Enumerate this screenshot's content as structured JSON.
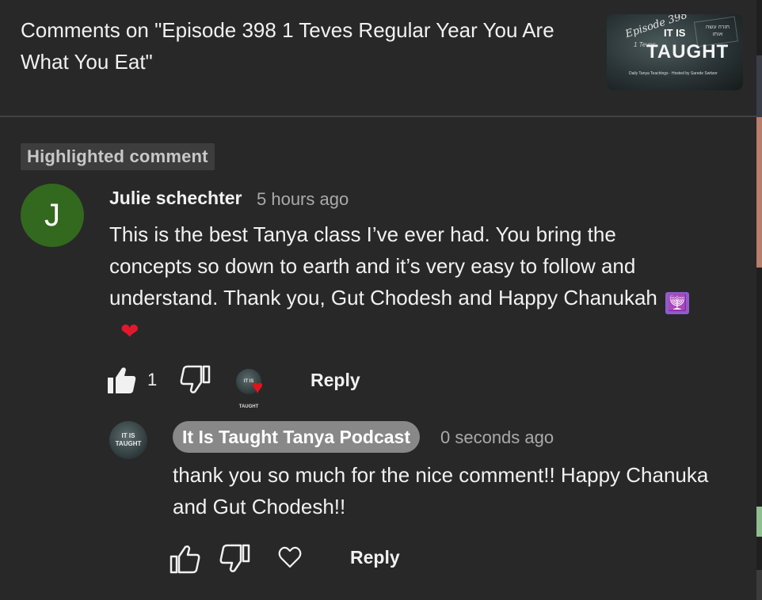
{
  "header": {
    "title": "Comments on \"Episode 398 1 Teves Regular Year You Are What You Eat\"",
    "thumbnail": {
      "episode_text": "Episode 398",
      "date_text": "1 Teves",
      "brand_top": "IT IS",
      "brand_main": "TAUGHT",
      "hebrew_text": "תורה עשה אותו",
      "subtitle": "Daily Tanya Teachings · Hosted by Sarede Switzer"
    }
  },
  "highlighted_label": "Highlighted comment",
  "comment": {
    "avatar_initial": "J",
    "avatar_color": "#33691e",
    "author": "Julie schechter",
    "time": "5 hours ago",
    "text": "This is the best Tanya class I’ve ever had. You bring the concepts so down to earth and it’s very easy to follow and understand. Thank you, Gut Chodesh and Happy Chanukah",
    "emojis": {
      "menorah": "🕎",
      "heart": "❤"
    },
    "like_count": "1",
    "like_icon": "thumbs-up-filled-icon",
    "dislike_icon": "thumbs-down-icon",
    "creator_heart_icon": "creator-heart-icon",
    "creator_avatar_text": "IT IS TAUGHT",
    "reply_label": "Reply"
  },
  "reply": {
    "avatar_text": "IT IS TAUGHT",
    "author": "It Is Taught Tanya Podcast",
    "time": "0 seconds ago",
    "text": "thank you so much for the nice comment!! Happy Chanuka and Gut Chodesh!!",
    "like_icon": "thumbs-up-outline-icon",
    "dislike_icon": "thumbs-down-icon",
    "heart_icon": "heart-outline-icon",
    "reply_label": "Reply"
  },
  "colors": {
    "background": "#282828",
    "owner_badge": "#888888",
    "heart_red": "#e3121d",
    "secondary_text": "#aaaaaa"
  }
}
